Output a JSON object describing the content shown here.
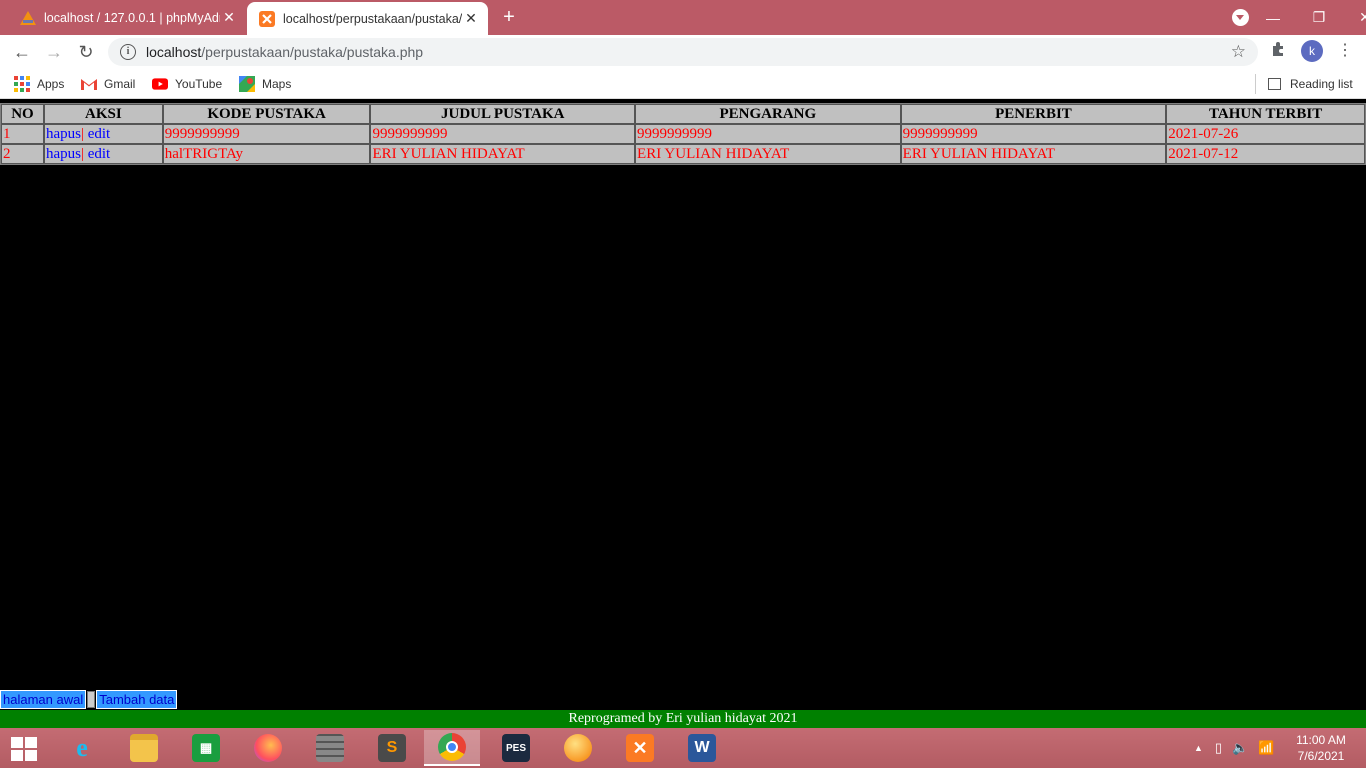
{
  "browser": {
    "tabs": [
      {
        "title": "localhost / 127.0.0.1 | phpMyAdm",
        "icon": "phpmyadmin-icon",
        "active": false
      },
      {
        "title": "localhost/perpustakaan/pustaka/",
        "icon": "xampp-icon",
        "active": true
      }
    ],
    "url_host": "localhost",
    "url_path": "/perpustakaan/pustaka/pustaka.php",
    "profile_initial": "k",
    "bookmarks": [
      {
        "label": "Apps",
        "icon": "apps-grid-icon"
      },
      {
        "label": "Gmail",
        "icon": "gmail-icon"
      },
      {
        "label": "YouTube",
        "icon": "youtube-icon"
      },
      {
        "label": "Maps",
        "icon": "maps-icon"
      }
    ],
    "reading_list": "Reading list"
  },
  "table": {
    "headers": [
      "NO",
      "AKSI",
      "KODE PUSTAKA",
      "JUDUL PUSTAKA",
      "PENGARANG",
      "PENERBIT",
      "TAHUN TERBIT"
    ],
    "rows": [
      {
        "no": "1",
        "hapus": "hapus",
        "sep": "|",
        "edit": "edit",
        "kode": "9999999999",
        "judul": "9999999999",
        "pengarang": "9999999999",
        "penerbit": "9999999999",
        "tahun": "2021-07-26"
      },
      {
        "no": "2",
        "hapus": "hapus",
        "sep": "|",
        "edit": "edit",
        "kode": "halTRIGTAy",
        "judul": "ERI YULIAN HIDAYAT",
        "pengarang": "ERI YULIAN HIDAYAT",
        "penerbit": "ERI YULIAN HIDAYAT",
        "tahun": "2021-07-12"
      }
    ]
  },
  "bottom_links": {
    "home": "halaman awal",
    "add": "Tambah data"
  },
  "footer": "Reprogramed by Eri yulian hidayat 2021",
  "taskbar": {
    "time": "11:00 AM",
    "date": "7/6/2021"
  },
  "colors": {
    "tabbar": "#bb5a66",
    "table_bg": "#c0c0c0",
    "cell_text": "#ff0000",
    "link": "#0000ff",
    "footer_bg": "#008000"
  }
}
